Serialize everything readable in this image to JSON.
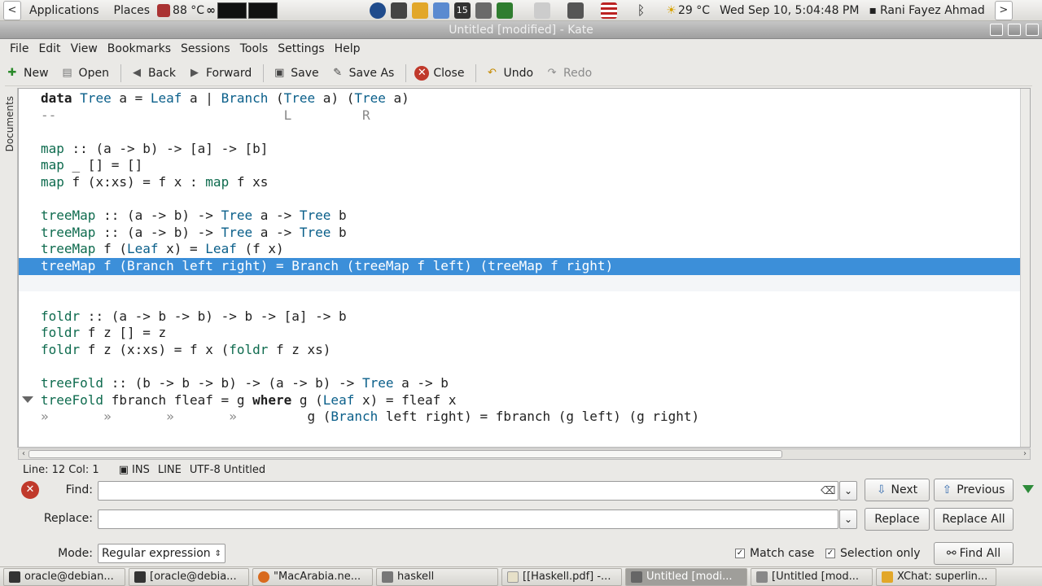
{
  "top_panel": {
    "applications": "Applications",
    "places": "Places",
    "cpu_temp": "88 °C",
    "weather": "29 °C",
    "datetime": "Wed Sep 10,  5:04:48 PM",
    "user": "Rani Fayez Ahmad",
    "calendar_day": "15"
  },
  "window": {
    "title": "Untitled [modified] - Kate"
  },
  "menu": [
    "File",
    "Edit",
    "View",
    "Bookmarks",
    "Sessions",
    "Tools",
    "Settings",
    "Help"
  ],
  "toolbar": {
    "new": "New",
    "open": "Open",
    "back": "Back",
    "forward": "Forward",
    "save": "Save",
    "save_as": "Save As",
    "close": "Close",
    "undo": "Undo",
    "redo": "Redo"
  },
  "side_tab": {
    "documents": "Documents"
  },
  "editor": {
    "lines": [
      "data Tree a = Leaf a | Branch (Tree a) (Tree a)",
      "--                             L         R",
      "",
      "map :: (a -> b) -> [a] -> [b]",
      "map _ [] = []",
      "map f (x:xs) = f x : map f xs",
      "",
      "treeMap :: (a -> b) -> Tree a -> Tree b",
      "treeMap :: (a -> b) -> Tree a -> Tree b",
      "treeMap f (Leaf x) = Leaf (f x)",
      "treeMap f (Branch left right) = Branch (treeMap f left) (treeMap f right)",
      "",
      "",
      "foldr :: (a -> b -> b) -> b -> [a] -> b",
      "foldr f z [] = z",
      "foldr f z (x:xs) = f x (foldr f z xs)",
      "",
      "treeFold :: (b -> b -> b) -> (a -> b) -> Tree a -> b",
      "treeFold fbranch fleaf = g where g (Leaf x) = fleaf x",
      "»       »       »       »         g (Branch left right) = fbranch (g left) (g right)"
    ]
  },
  "status": {
    "position": "Line: 12 Col: 1",
    "mode": "INS",
    "selection_mode": "LINE",
    "encoding": "UTF-8",
    "filename": "Untitled"
  },
  "find_bar": {
    "find_label": "Find:",
    "find_value": "",
    "replace_label": "Replace:",
    "replace_value": "",
    "mode_label": "Mode:",
    "mode_value": "Regular expression",
    "next": "Next",
    "previous": "Previous",
    "replace": "Replace",
    "replace_all": "Replace All",
    "find_all": "Find All",
    "match_case": "Match case",
    "selection_only": "Selection only",
    "match_case_checked": true,
    "selection_only_checked": true
  },
  "taskbar": [
    {
      "label": "oracle@debian...",
      "active": false
    },
    {
      "label": "[oracle@debia...",
      "active": false
    },
    {
      "label": "\"MacArabia.ne...",
      "active": false
    },
    {
      "label": "haskell",
      "active": false
    },
    {
      "label": "[[Haskell.pdf] -...",
      "active": false
    },
    {
      "label": "Untitled [modi...",
      "active": true
    },
    {
      "label": "[Untitled [mod...",
      "active": false
    },
    {
      "label": "XChat: superlin...",
      "active": false
    }
  ],
  "colors": {
    "selection": "#3c8fd9",
    "type": "#0a5f8a",
    "function": "#0e6b4e"
  }
}
